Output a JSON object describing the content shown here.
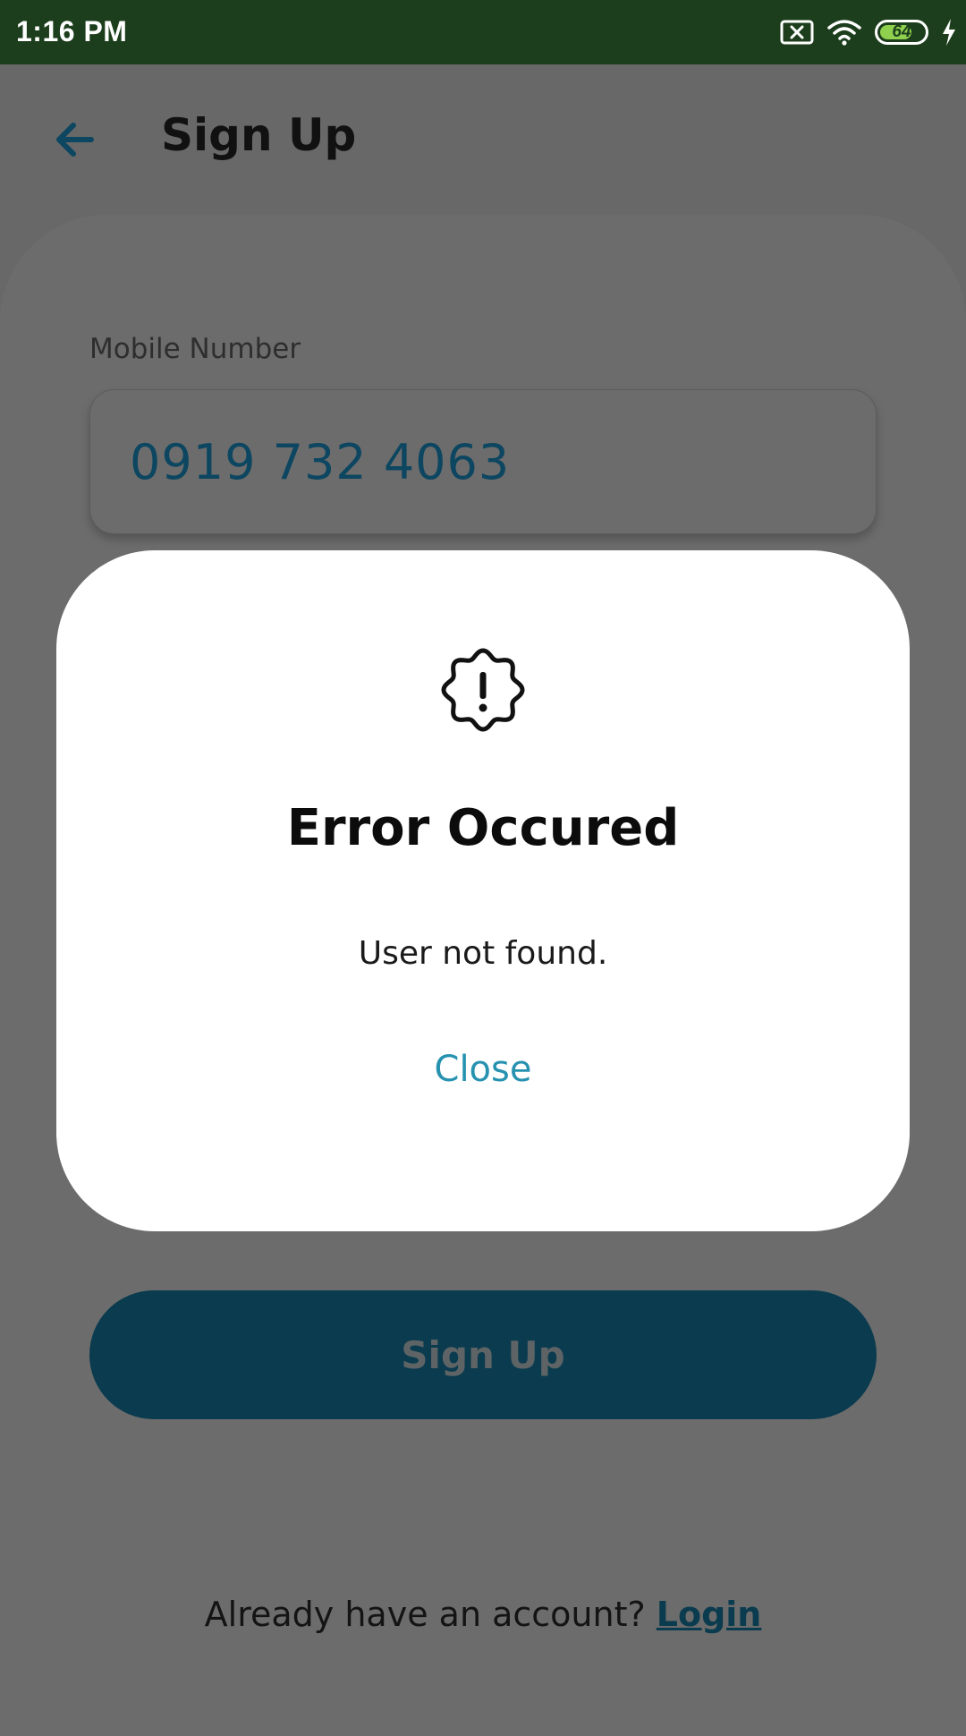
{
  "status_bar": {
    "time": "1:16 PM",
    "battery_level": "64",
    "icons": [
      "sim-none-icon",
      "wifi-icon",
      "battery-icon",
      "charging-icon"
    ]
  },
  "header": {
    "back_icon": "arrow-left-icon",
    "title": "Sign Up"
  },
  "form": {
    "mobile_label": "Mobile Number",
    "mobile_value": "0919 732 4063",
    "submit_label": "Sign Up"
  },
  "footer": {
    "prompt": "Already have an account? ",
    "link": "Login"
  },
  "dialog": {
    "icon": "alert-badge-icon",
    "title": "Error Occured",
    "message": "User not found.",
    "close_label": "Close"
  },
  "colors": {
    "status_bar": "#1c3e1c",
    "overlay": "#686868",
    "primary": "#0a3b4e",
    "accent": "#2792b0",
    "battery": "#8fd14f"
  }
}
